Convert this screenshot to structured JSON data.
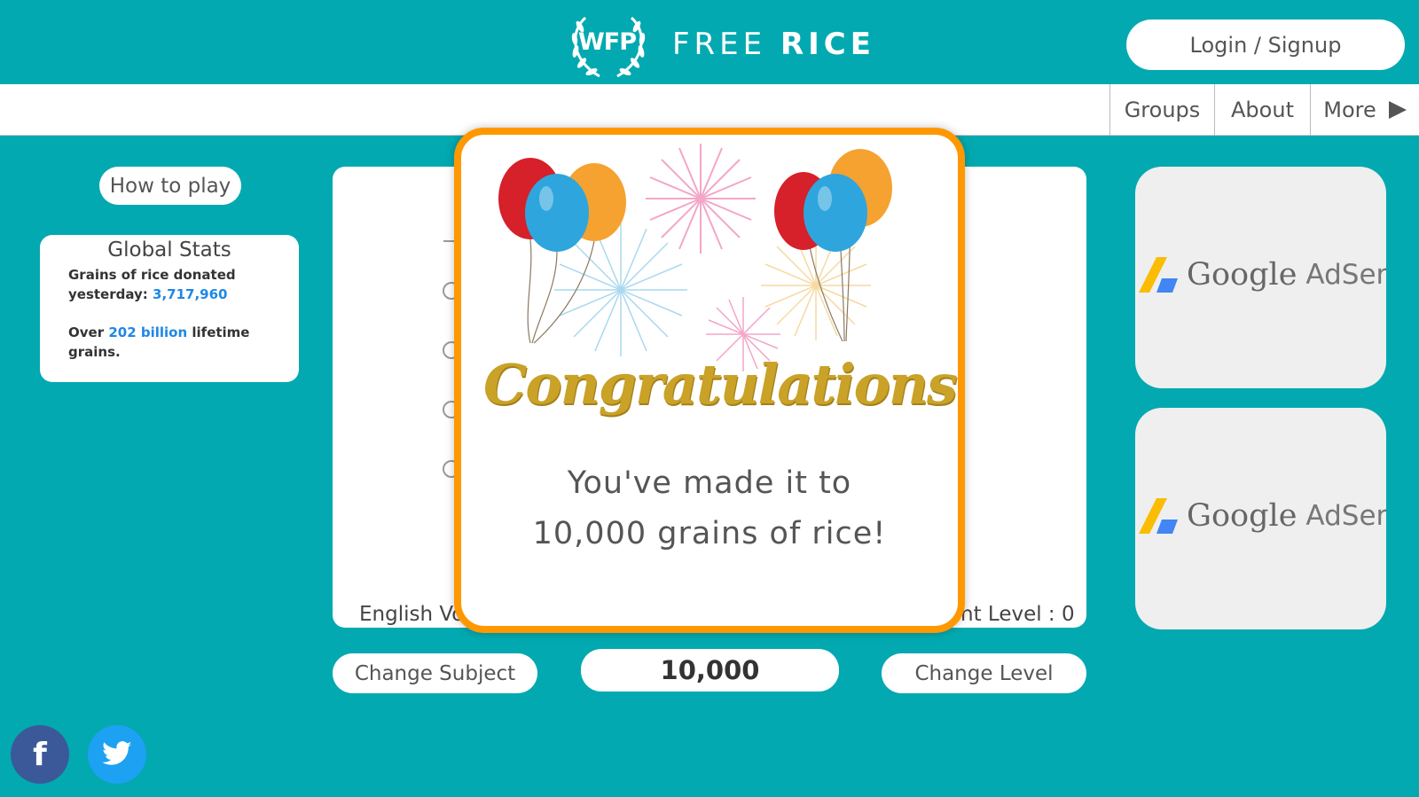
{
  "header": {
    "logo_wfp": "WFP",
    "brand_light": "FREE ",
    "brand_bold": "RICE",
    "login_label": "Login / Signup"
  },
  "nav": {
    "items": [
      {
        "label": "Groups"
      },
      {
        "label": "About"
      },
      {
        "label": "More"
      }
    ]
  },
  "sidebar": {
    "how_to_play": "How to play",
    "stats_title": "Global Stats",
    "donated_prefix": "Grains of rice donated yesterday: ",
    "donated_value": "3,717,960",
    "lifetime_prefix": "Over ",
    "lifetime_value": "202 billion",
    "lifetime_suffix": " lifetime grains."
  },
  "game": {
    "subject_partial": "English Vo",
    "level_partial": "nt Level : 0",
    "change_subject": "Change Subject",
    "score": "10,000",
    "change_level": "Change Level"
  },
  "ads": [
    {
      "google": "Google",
      "adsense": "AdSense"
    },
    {
      "google": "Google",
      "adsense": "AdSense"
    }
  ],
  "social": {
    "facebook_glyph": "f"
  },
  "modal": {
    "banner": "Congratulations",
    "line1": "You've made it to",
    "line2": "10,000 grains of rice!"
  },
  "colors": {
    "background": "#03a9b0",
    "modal_border": "#ff9800",
    "link_blue": "#1e88e5",
    "gold": "#c9a227",
    "facebook": "#3b5998",
    "twitter": "#1da1f2"
  },
  "icons": [
    "wfp-laurel-icon",
    "rice-grain-icon",
    "chevron-right-icon",
    "adsense-icon",
    "facebook-icon",
    "twitter-icon",
    "balloon-icon",
    "firework-icon"
  ]
}
